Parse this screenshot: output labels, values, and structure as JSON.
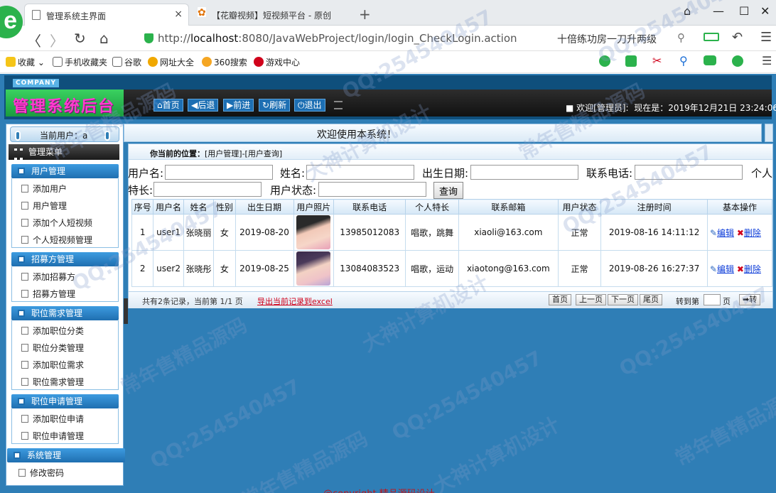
{
  "browser": {
    "logo_letter": "e",
    "tabs": [
      {
        "label": "管理系统主界面",
        "close": "×"
      },
      {
        "label": "【花瓣视频】短视频平台 - 原创",
        "close": ""
      }
    ],
    "new_tab": "+",
    "window_buttons": [
      "⌂",
      "—",
      "☐",
      "✕"
    ],
    "nav_buttons": [
      "〈",
      "〉",
      "↻",
      "⌂"
    ],
    "url_prefix": "http://",
    "url_host": "localhost",
    "url_rest": ":8080/JavaWebProject/login/login_CheckLogin.action",
    "search_text": "十倍练功房一刀升两级",
    "bookmarks": [
      "收藏",
      "手机收藏夹",
      "谷歌",
      "网址大全",
      "360搜索",
      "游戏中心"
    ]
  },
  "app": {
    "company_badge": "COMPANY",
    "title": "管理系统后台",
    "topnav": [
      "首页",
      "后退",
      "前进",
      "刷新",
      "退出"
    ],
    "welcome_user": "■ 欢迎[管理员]:",
    "now_label": "现在是：",
    "now_time": "2019年12月21日 23:24:06",
    "welcome_message": "欢迎使用本系统！"
  },
  "sidebar": {
    "current_user": "当前用户：a",
    "menu_title": "管理菜单",
    "groups": [
      {
        "title": "用户管理",
        "items": [
          "添加用户",
          "用户管理",
          "添加个人短视频",
          "个人短视频管理"
        ]
      },
      {
        "title": "招募方管理",
        "items": [
          "添加招募方",
          "招募方管理"
        ]
      },
      {
        "title": "职位需求管理",
        "items": [
          "添加职位分类",
          "职位分类管理",
          "添加职位需求",
          "职位需求管理"
        ]
      },
      {
        "title": "职位申请管理",
        "items": [
          "添加职位申请",
          "职位申请管理"
        ]
      },
      {
        "title": "系统管理",
        "items": [
          "修改密码"
        ]
      }
    ]
  },
  "breadcrumb": {
    "label": "你当前的位置：",
    "path": "[用户管理]-[用户查询]"
  },
  "search_form": {
    "username_label": "用户名:",
    "name_label": "姓名:",
    "birthday_label": "出生日期:",
    "phone_label": "联系电话:",
    "specialty_label": "个人特长:",
    "specialty_label_line1": "个人",
    "specialty_label_line2": "特长:",
    "status_label": "用户状态:",
    "query_button": "查询"
  },
  "table": {
    "headers": [
      "序号",
      "用户名",
      "姓名",
      "性别",
      "出生日期",
      "用户照片",
      "联系电话",
      "个人特长",
      "联系邮箱",
      "用户状态",
      "注册时间",
      "基本操作"
    ],
    "rows": [
      {
        "no": "1",
        "username": "user1",
        "name": "张晓丽",
        "gender": "女",
        "birthday": "2019-08-20",
        "phone": "13985012083",
        "specialty": "唱歌，跳舞",
        "email": "xiaoli@163.com",
        "status": "正常",
        "regtime": "2019-08-16 14:11:12",
        "edit": "编辑",
        "delete": "删除"
      },
      {
        "no": "2",
        "username": "user2",
        "name": "张晓彤",
        "gender": "女",
        "birthday": "2019-08-25",
        "phone": "13084083523",
        "specialty": "唱歌，运动",
        "email": "xiaotong@163.com",
        "status": "正常",
        "regtime": "2019-08-26 16:27:37",
        "edit": "编辑",
        "delete": "删除"
      }
    ]
  },
  "pager": {
    "info": "共有2条记录，当前第 1/1 页",
    "export": "导出当前记录到excel",
    "buttons": [
      "首页",
      "上一页",
      "下一页",
      "尾页"
    ],
    "goto_label": "转到第",
    "goto_unit": "页",
    "goto_button": "➡转"
  },
  "footer": {
    "copyright": "@copyright 精品源码设计"
  },
  "watermarks": [
    "QQ:254540457",
    "常年售精品源码",
    "大神计算机设计"
  ]
}
